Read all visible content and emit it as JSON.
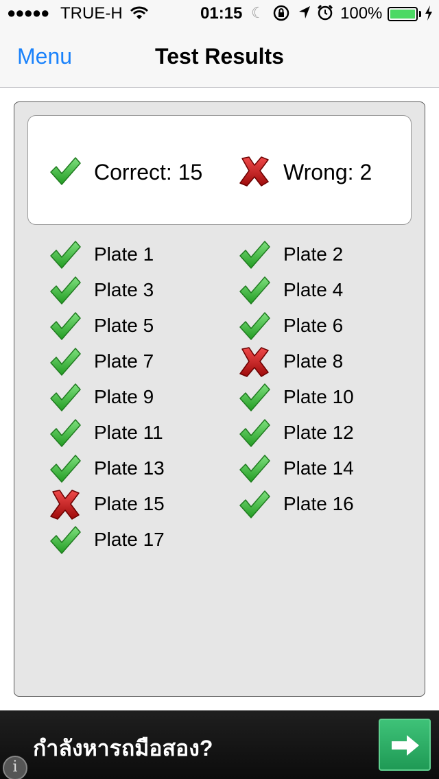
{
  "status_bar": {
    "signal": "●●●●●",
    "carrier": "TRUE-H",
    "time": "01:15",
    "battery_pct": "100%",
    "battery_level": 1.0,
    "icons": [
      "signal-dots-icon",
      "wifi-icon",
      "moon-icon",
      "orientation-lock-icon",
      "location-arrow-icon",
      "alarm-icon",
      "battery-icon",
      "charging-bolt-icon"
    ]
  },
  "nav": {
    "menu_label": "Menu",
    "title": "Test Results"
  },
  "summary": {
    "correct_label": "Correct: 15",
    "wrong_label": "Wrong: 2"
  },
  "plates": [
    {
      "label": "Plate 1",
      "status": "correct"
    },
    {
      "label": "Plate 2",
      "status": "correct"
    },
    {
      "label": "Plate 3",
      "status": "correct"
    },
    {
      "label": "Plate 4",
      "status": "correct"
    },
    {
      "label": "Plate 5",
      "status": "correct"
    },
    {
      "label": "Plate 6",
      "status": "correct"
    },
    {
      "label": "Plate 7",
      "status": "correct"
    },
    {
      "label": "Plate 8",
      "status": "wrong"
    },
    {
      "label": "Plate 9",
      "status": "correct"
    },
    {
      "label": "Plate 10",
      "status": "correct"
    },
    {
      "label": "Plate 11",
      "status": "correct"
    },
    {
      "label": "Plate 12",
      "status": "correct"
    },
    {
      "label": "Plate 13",
      "status": "correct"
    },
    {
      "label": "Plate 14",
      "status": "correct"
    },
    {
      "label": "Plate 15",
      "status": "wrong"
    },
    {
      "label": "Plate 16",
      "status": "correct"
    },
    {
      "label": "Plate 17",
      "status": "correct"
    }
  ],
  "ad": {
    "text": "กำลังหารถมือสอง?",
    "icons": [
      "arrow-right-icon",
      "info-icon"
    ]
  },
  "colors": {
    "accent": "#1a82fb",
    "check_green": "#3cc23c",
    "cross_red": "#d11a1a",
    "battery_green": "#4cd964",
    "ad_button": "#2fae66"
  }
}
